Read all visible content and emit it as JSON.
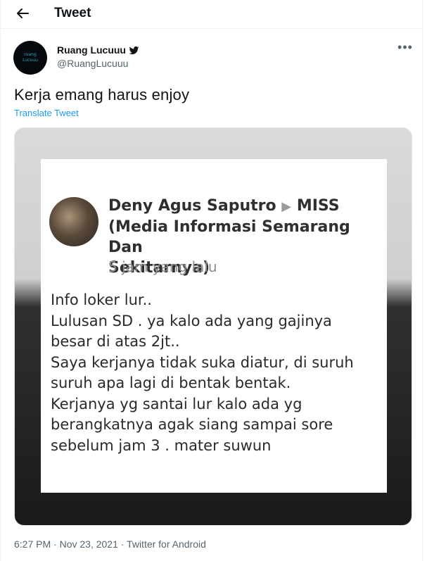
{
  "header": {
    "title": "Tweet",
    "back_icon": "back-arrow-icon"
  },
  "author": {
    "name": "Ruang Lucuuu",
    "handle": "@RuangLucuuu",
    "verified_icon": "twitter-bird-icon",
    "avatar_text": [
      "ruang",
      "Lucuuu"
    ]
  },
  "more_icon": "more-options-icon",
  "tweet": {
    "text": "Kerja emang harus enjoy",
    "translate_label": "Translate Tweet"
  },
  "media": {
    "post_author": "Deny Agus Saputro",
    "post_target": "MISS",
    "post_group_line1": "(Media Informasi Semarang Dan",
    "post_group_line2": "Sekitarnya)",
    "post_time": "5 jam yang lalu",
    "body_lines": [
      "Info loker lur..",
      "Lulusan SD . ya kalo ada yang gajinya",
      "besar di atas 2jt..",
      "Saya kerjanya tidak suka diatur, di suruh",
      "suruh apa lagi di bentak bentak.",
      "Kerjanya yg santai lur kalo ada yg",
      "berangkatnya agak siang sampai sore",
      "sebelum jam 3 . mater suwun"
    ]
  },
  "meta": "6:27 PM · Nov 23, 2021 · Twitter for Android",
  "colors": {
    "link": "#1d9bf0",
    "secondary_text": "#536471",
    "primary_text": "#0f1419"
  }
}
